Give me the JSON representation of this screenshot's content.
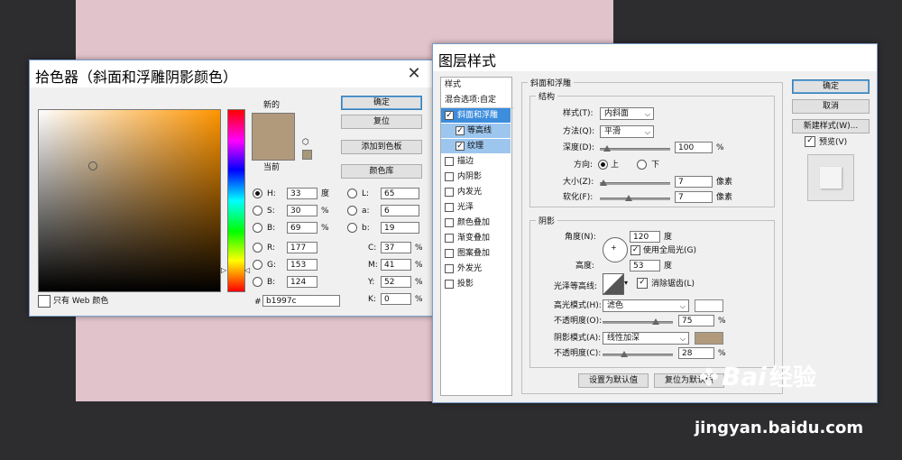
{
  "picker": {
    "title": "拾色器（斜面和浮雕阴影颜色）",
    "new_label": "新的",
    "current_label": "当前",
    "new_color": "#b1997c",
    "current_color": "#b1997c",
    "ok": "确定",
    "reset": "复位",
    "add_swatch": "添加到色板",
    "libraries": "颜色库",
    "web_only": "只有 Web 颜色",
    "hex_label": "#",
    "hex": "b1997c",
    "fields": {
      "H": {
        "label": "H:",
        "value": "33",
        "unit": "度"
      },
      "S": {
        "label": "S:",
        "value": "30",
        "unit": "%"
      },
      "B": {
        "label": "B:",
        "value": "69",
        "unit": "%"
      },
      "R": {
        "label": "R:",
        "value": "177"
      },
      "G": {
        "label": "G:",
        "value": "153"
      },
      "Bl": {
        "label": "B:",
        "value": "124"
      },
      "L": {
        "label": "L:",
        "value": "65"
      },
      "a": {
        "label": "a:",
        "value": "6"
      },
      "b": {
        "label": "b:",
        "value": "19"
      },
      "C": {
        "label": "C:",
        "value": "37",
        "unit": "%"
      },
      "M": {
        "label": "M:",
        "value": "41",
        "unit": "%"
      },
      "Y": {
        "label": "Y:",
        "value": "52",
        "unit": "%"
      },
      "K": {
        "label": "K:",
        "value": "0",
        "unit": "%"
      }
    }
  },
  "layer_style": {
    "title": "图层样式",
    "list_header": "样式",
    "blend_options": "混合选项:自定",
    "items": [
      {
        "label": "斜面和浮雕",
        "checked": true
      },
      {
        "label": "等高线",
        "checked": true
      },
      {
        "label": "纹理",
        "checked": true
      },
      {
        "label": "描边",
        "checked": false
      },
      {
        "label": "内阴影",
        "checked": false
      },
      {
        "label": "内发光",
        "checked": false
      },
      {
        "label": "光泽",
        "checked": false
      },
      {
        "label": "颜色叠加",
        "checked": false
      },
      {
        "label": "渐变叠加",
        "checked": false
      },
      {
        "label": "图案叠加",
        "checked": false
      },
      {
        "label": "外发光",
        "checked": false
      },
      {
        "label": "投影",
        "checked": false
      }
    ],
    "section_title": "斜面和浮雕",
    "structure": {
      "title": "结构",
      "style_label": "样式(T):",
      "style_value": "内斜面",
      "method_label": "方法(Q):",
      "method_value": "平滑",
      "depth_label": "深度(D):",
      "depth_value": "100",
      "depth_unit": "%",
      "direction_label": "方向:",
      "dir_up": "上",
      "dir_down": "下",
      "size_label": "大小(Z):",
      "size_value": "7",
      "size_unit": "像素",
      "soften_label": "软化(F):",
      "soften_value": "7",
      "soften_unit": "像素"
    },
    "shading": {
      "title": "阴影",
      "angle_label": "角度(N):",
      "angle_value": "120",
      "angle_unit": "度",
      "global_light": "使用全局光(G)",
      "altitude_label": "高度:",
      "altitude_value": "53",
      "altitude_unit": "度",
      "gloss_label": "光泽等高线:",
      "antialias": "消除锯齿(L)",
      "highlight_label": "高光模式(H):",
      "highlight_value": "滤色",
      "highlight_color": "#ffffff",
      "opacity1_label": "不透明度(O):",
      "opacity1_value": "75",
      "opacity1_unit": "%",
      "shadow_label": "阴影模式(A):",
      "shadow_value": "线性加深",
      "shadow_color": "#b1997c",
      "opacity2_label": "不透明度(C):",
      "opacity2_value": "28",
      "opacity2_unit": "%"
    },
    "make_default": "设置为默认值",
    "reset_default": "复位为默认值",
    "ok": "确定",
    "cancel": "取消",
    "new_style": "新建样式(W)...",
    "preview": "预览(V)"
  },
  "watermark": {
    "brand": "Bai",
    "brand2": "经验",
    "url": "jingyan.baidu.com"
  }
}
